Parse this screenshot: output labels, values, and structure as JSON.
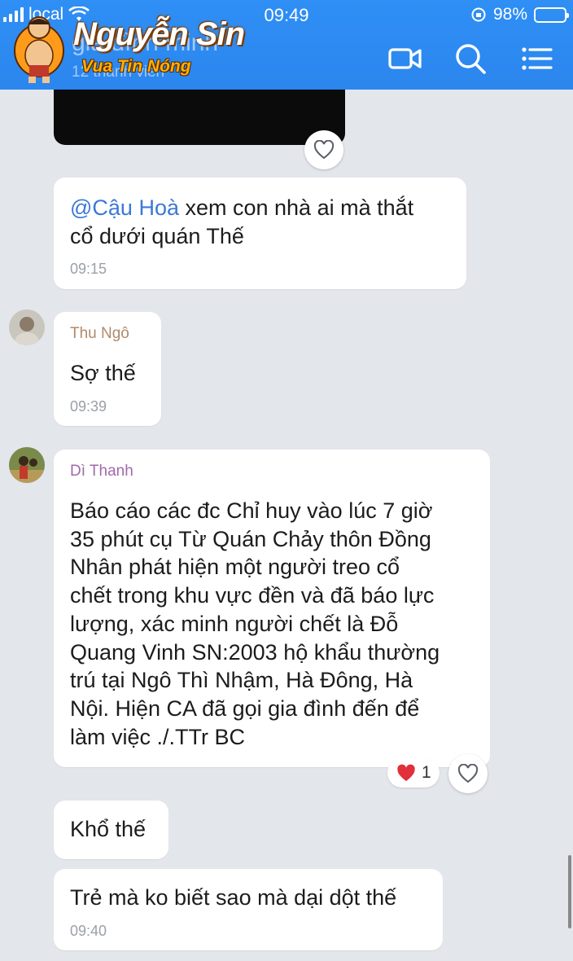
{
  "status_bar": {
    "carrier": "local",
    "time": "09:49",
    "battery": "98%",
    "battery_level": 0.98
  },
  "header": {
    "group_name": "gia đình minh",
    "member_count": "12 thành viên",
    "watermark_title": "Nguyễn Sin",
    "watermark_subtitle": "Vua Tin Nóng",
    "icons": [
      "video-call-icon",
      "search-icon",
      "menu-icon"
    ]
  },
  "messages": [
    {
      "id": "m1",
      "mention": "@Cậu Hoà",
      "text_line1": " xem con nhà ai mà thắt",
      "text_line2": "cổ dưới quán Thế",
      "time": "09:15"
    },
    {
      "id": "m2",
      "sender": "Thu Ngô",
      "text": "Sợ thế",
      "time": "09:39"
    },
    {
      "id": "m3",
      "sender": "Dì Thanh",
      "lines": [
        "Báo cáo các đc Chỉ huy vào lúc 7 giờ",
        "35 phút cụ Từ Quán Chảy thôn Đồng",
        "Nhân phát hiện một người treo cổ",
        "chết trong khu vực đền và đã báo lực",
        "lượng, xác minh người chết là Đỗ",
        "Quang Vinh SN:2003 hộ khẩu thường",
        "trú tại Ngô Thì Nhậm, Hà Đông, Hà",
        "Nội. Hiện CA đã gọi gia đình đến để",
        "làm việc ./.TTr BC"
      ],
      "reaction_count": "1"
    },
    {
      "id": "m4",
      "text": "Khổ thế"
    },
    {
      "id": "m5",
      "text": "Trẻ mà ko biết sao mà dại dột thế",
      "time": "09:40"
    }
  ],
  "colors": {
    "header_blue": "#2f8ff5",
    "chat_bg": "#e3e6eb",
    "mention_blue": "#3b79d6",
    "sender_thu_ngo": "#b08a6a",
    "sender_di_thanh": "#a06aa8",
    "reaction_heart": "#e0303a"
  }
}
